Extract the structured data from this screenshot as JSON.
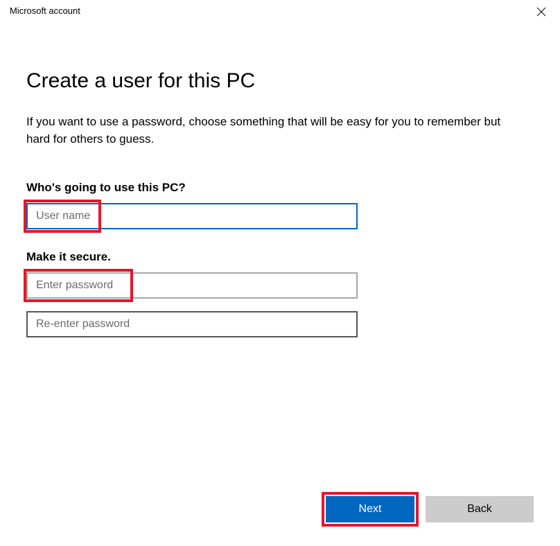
{
  "titlebar": {
    "title": "Microsoft account"
  },
  "main": {
    "heading": "Create a user for this PC",
    "description": "If you want to use a password, choose something that will be easy for you to remember but hard for others to guess.",
    "section_user_label": "Who's going to use this PC?",
    "section_secure_label": "Make it secure.",
    "username_placeholder": "User name",
    "password_placeholder": "Enter password",
    "repassword_placeholder": "Re-enter password"
  },
  "buttons": {
    "next": "Next",
    "back": "Back"
  }
}
